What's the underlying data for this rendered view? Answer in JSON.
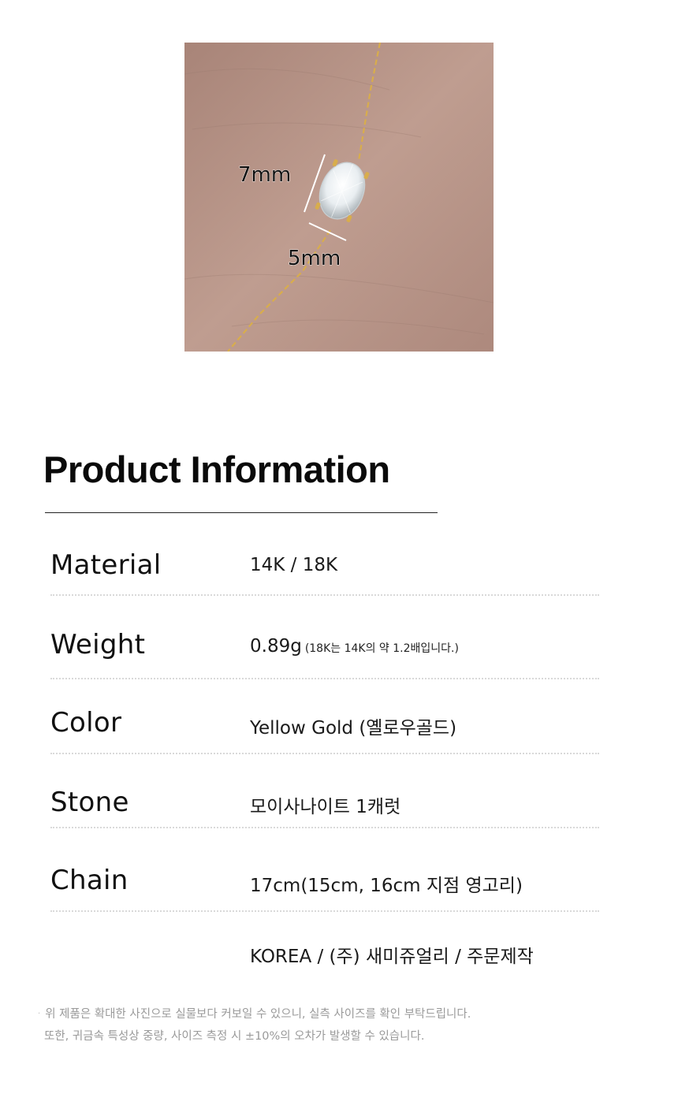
{
  "photo": {
    "dim_height": "7mm",
    "dim_width": "5mm",
    "skin_color": "#b59488",
    "gold_color": "#d8ad4c"
  },
  "title": "Product Information",
  "specs": [
    {
      "label": "Material",
      "value": "14K / 18K",
      "note": ""
    },
    {
      "label": "Weight",
      "value": "0.89g",
      "note": "(18K는 14K의 약 1.2배입니다.)"
    },
    {
      "label": "Color",
      "value": "Yellow Gold (옐로우골드)",
      "note": ""
    },
    {
      "label": "Stone",
      "value": "모이사나이트 1캐럿",
      "note": ""
    },
    {
      "label": "Chain",
      "value": "17cm(15cm, 16cm 지점 영고리)",
      "note": ""
    },
    {
      "label": "",
      "value": "KOREA / (주) 새미쥬얼리 / 주문제작",
      "note": ""
    }
  ],
  "footnotes": [
    "위 제품은 확대한 사진으로 실물보다 커보일 수 있으니, 실측 사이즈를 확인 부탁드립니다.",
    "또한, 귀금속 특성상 중량,  사이즈 측정 시 ±10%의 오차가 발생할 수 있습니다."
  ]
}
